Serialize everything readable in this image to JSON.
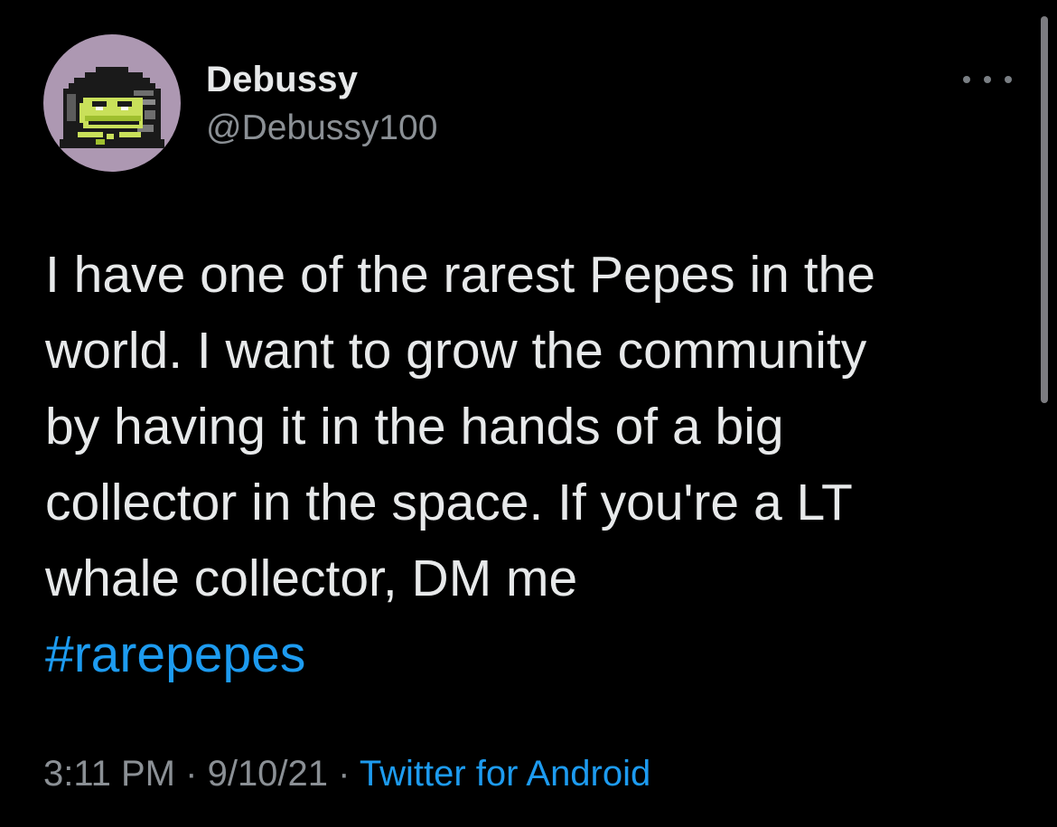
{
  "tweet": {
    "author": {
      "display_name": "Debussy",
      "handle": "@Debussy100",
      "avatar_icon": "pixel-pepe-avatar"
    },
    "more_icon": "more-horizontal-icon",
    "text_lines": [
      "I have one of the rarest Pepes in the",
      "world. I want to grow the community",
      "by having it in the hands of a big",
      "collector in the space. If you're a LT",
      "whale collector, DM me"
    ],
    "hashtag": "#rarepepes",
    "time": "3:11 PM",
    "separator": "·",
    "date": "9/10/21",
    "source": "Twitter for Android"
  },
  "colors": {
    "background": "#000000",
    "text": "#e7e9ea",
    "secondary_text": "#8b9095",
    "link": "#1d9bf0",
    "avatar_bg": "#ad98b2"
  }
}
